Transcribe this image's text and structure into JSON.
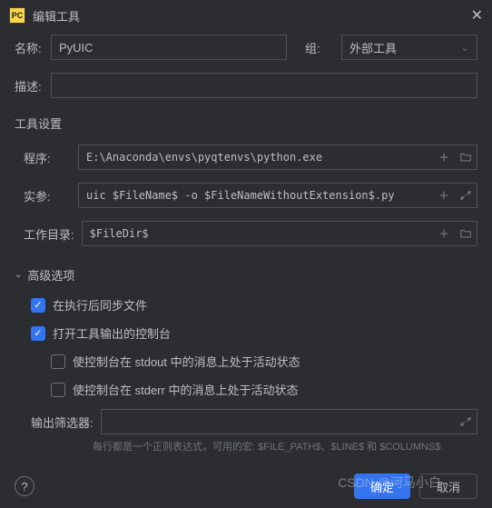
{
  "title": "编辑工具",
  "labels": {
    "name": "名称:",
    "group": "组:",
    "desc": "描述:",
    "tool_settings": "工具设置",
    "program": "程序:",
    "args": "实参:",
    "workdir": "工作目录:",
    "advanced": "高级选项",
    "sync": "在执行后同步文件",
    "console": "打开工具输出的控制台",
    "stdout": "使控制台在 stdout 中的消息上处于活动状态",
    "stderr": "使控制台在 stderr 中的消息上处于活动状态",
    "filter": "输出筛选器:",
    "hint": "每行都是一个正则表达式，可用的宏: $FILE_PATH$、$LINE$ 和 $COLUMNS$",
    "ok": "确定",
    "cancel": "取消"
  },
  "values": {
    "name": "PyUIC",
    "group": "外部工具",
    "desc": "",
    "program": "E:\\Anaconda\\envs\\pyqtenvs\\python.exe",
    "args": "uic $FileName$ -o $FileNameWithoutExtension$.py",
    "workdir": "$FileDir$",
    "filter": ""
  },
  "checks": {
    "sync": true,
    "console": true,
    "stdout": false,
    "stderr": false
  },
  "watermark": "CSDN @河马小白"
}
